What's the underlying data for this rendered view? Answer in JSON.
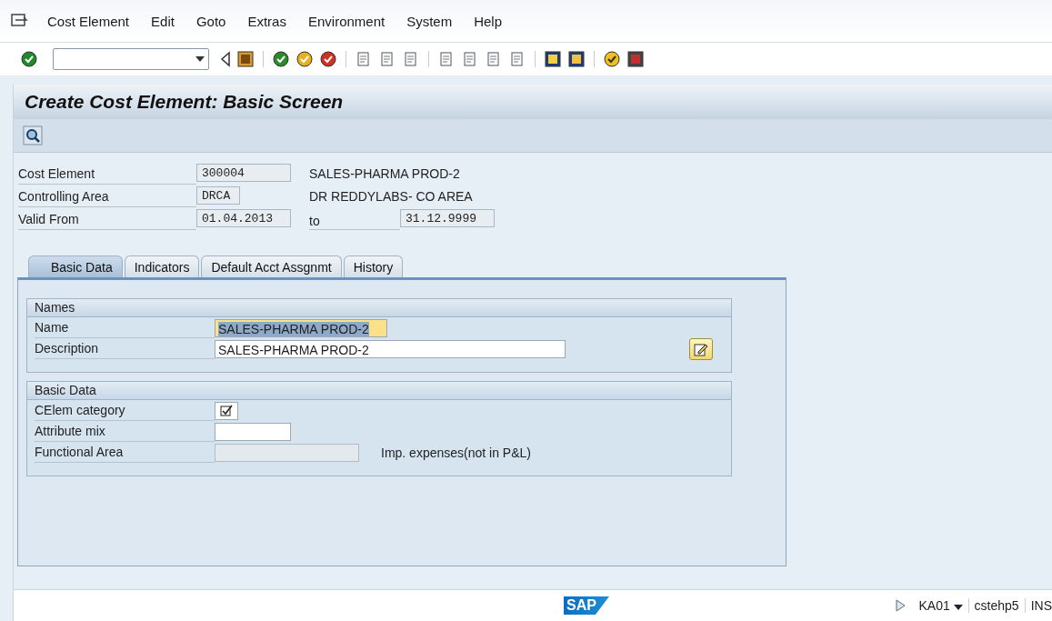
{
  "menu": [
    {
      "label": "Cost Element"
    },
    {
      "label": "Edit"
    },
    {
      "label": "Goto"
    },
    {
      "label": "Extras"
    },
    {
      "label": "Environment"
    },
    {
      "label": "System"
    },
    {
      "label": "Help"
    }
  ],
  "title": "Create Cost Element: Basic Screen",
  "header_fields": [
    {
      "label": "Cost Element",
      "value": "300004",
      "description": "SALES-PHARMA PROD-2"
    },
    {
      "label": "Controlling Area",
      "value": "DRCA",
      "description": "DR REDDYLABS- CO AREA"
    },
    {
      "label": "Valid From",
      "value": "01.04.2013",
      "to_label": "to",
      "to_value": "31.12.9999"
    }
  ],
  "tabs": [
    {
      "label": "Basic Data",
      "selected": true
    },
    {
      "label": "Indicators",
      "selected": false
    },
    {
      "label": "Default Acct Assgnmt",
      "selected": false
    },
    {
      "label": "History",
      "selected": false
    }
  ],
  "groups": [
    {
      "title": "Names",
      "rows": [
        {
          "kind": "text",
          "label": "Name",
          "value": "SALES-PHARMA PROD-2",
          "text_selected": true
        },
        {
          "kind": "text_action",
          "label": "Description",
          "value": "SALES-PHARMA PROD-2"
        }
      ]
    },
    {
      "title": "Basic Data",
      "rows": [
        {
          "kind": "checkbox",
          "label": "CElem category",
          "checked": true
        },
        {
          "kind": "text",
          "label": "Attribute mix"
        },
        {
          "kind": "text",
          "label": "Functional Area",
          "disabled": true,
          "note": "Imp. expenses(not in P&L)"
        }
      ]
    }
  ],
  "status_bar": {
    "logo": "SAP",
    "transaction": "KA01",
    "server": "cstehp5",
    "mode": "INS"
  }
}
